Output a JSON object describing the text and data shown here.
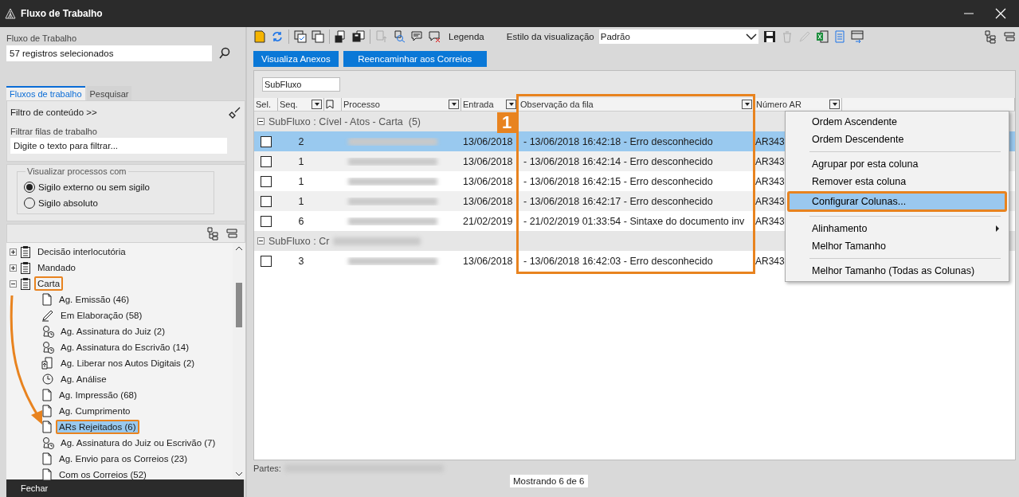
{
  "window": {
    "title": "Fluxo de Trabalho"
  },
  "left_panel": {
    "label": "Fluxo de Trabalho",
    "search_value": "57 registros selecionados",
    "tabs": [
      {
        "label": "Fluxos de trabalho",
        "selected": true
      },
      {
        "label": "Pesquisar",
        "selected": false
      }
    ],
    "content_filter": "Filtro de conteúdo >>",
    "filter_label": "Filtrar filas de trabalho",
    "filter_placeholder": "Digite o texto para filtrar...",
    "visibility": {
      "title": "Visualizar processos com",
      "options": [
        {
          "label": "Sigilo externo ou sem sigilo",
          "selected": true
        },
        {
          "label": "Sigilo absoluto",
          "selected": false
        }
      ]
    },
    "tree": [
      {
        "label": "Decisão interlocutória",
        "expanded": false,
        "callout": false
      },
      {
        "label": "Mandado",
        "expanded": false,
        "callout": false
      },
      {
        "label": "Carta",
        "expanded": true,
        "callout": true,
        "children": [
          {
            "label": "Ag. Emissão (46)",
            "kind": "document",
            "selected": false,
            "callout": false
          },
          {
            "label": "Em Elaboração (58)",
            "kind": "pen",
            "selected": false,
            "callout": false
          },
          {
            "label": "Ag. Assinatura do Juiz (2)",
            "kind": "signature",
            "selected": false,
            "callout": false
          },
          {
            "label": "Ag. Assinatura do Escrivão (14)",
            "kind": "signature",
            "selected": false,
            "callout": false
          },
          {
            "label": "Ag. Liberar nos Autos Digitais (2)",
            "kind": "release",
            "selected": false,
            "callout": false
          },
          {
            "label": "Ag. Análise",
            "kind": "clock",
            "selected": false,
            "callout": false
          },
          {
            "label": "Ag. Impressão (68)",
            "kind": "document",
            "selected": false,
            "callout": false
          },
          {
            "label": "Ag. Cumprimento",
            "kind": "document",
            "selected": false,
            "callout": false
          },
          {
            "label": "ARs Rejeitados (6)",
            "kind": "document",
            "selected": true,
            "callout": true
          },
          {
            "label": "Ag. Assinatura do Juiz ou Escrivão (7)",
            "kind": "signature",
            "selected": false,
            "callout": false
          },
          {
            "label": "Ag. Envio para os Correios (23)",
            "kind": "document",
            "selected": false,
            "callout": false
          },
          {
            "label": "Com os Correios (52)",
            "kind": "document",
            "selected": false,
            "callout": false
          }
        ]
      }
    ],
    "close_button": "Fechar"
  },
  "toolbar": {
    "legend": "Legenda",
    "view_style_label": "Estilo da visualização",
    "view_style_value": "Padrão"
  },
  "action_buttons": [
    "Visualiza Anexos",
    "Reencaminhar aos Correios"
  ],
  "group_by": [
    "SubFluxo"
  ],
  "table": {
    "columns": [
      {
        "label": "Sel.",
        "callout": false
      },
      {
        "label": "Seq.",
        "callout": false
      },
      {
        "label": "Processo",
        "callout": false
      },
      {
        "label": "Entrada",
        "callout": false
      },
      {
        "label": "Observação da fila",
        "callout": true,
        "callout_label": "1"
      },
      {
        "label": "Número AR",
        "callout": false
      }
    ],
    "groups": [
      {
        "title": "SubFluxo : Cível - Atos - Carta  (5)",
        "rows": [
          {
            "selected": true,
            "checked": false,
            "seq": "2",
            "entrada": "13/06/2018",
            "observacao": "- 13/06/2018 16:42:18 - Erro desconhecido",
            "numero_ar": "AR343"
          },
          {
            "selected": false,
            "checked": false,
            "seq": "1",
            "entrada": "13/06/2018",
            "observacao": "- 13/06/2018 16:42:14 - Erro desconhecido",
            "numero_ar": "AR343"
          },
          {
            "selected": false,
            "checked": false,
            "seq": "1",
            "entrada": "13/06/2018",
            "observacao": "- 13/06/2018 16:42:15 - Erro desconhecido",
            "numero_ar": "AR343"
          },
          {
            "selected": false,
            "checked": false,
            "seq": "1",
            "entrada": "13/06/2018",
            "observacao": "- 13/06/2018 16:42:17 - Erro desconhecido",
            "numero_ar": "AR343"
          },
          {
            "selected": false,
            "checked": false,
            "seq": "6",
            "entrada": "21/02/2019",
            "observacao": "- 21/02/2019 01:33:54 - Sintaxe do documento inv",
            "numero_ar": "AR343"
          }
        ]
      },
      {
        "title": "SubFluxo : Cr",
        "rows": [
          {
            "selected": false,
            "checked": false,
            "seq": "3",
            "entrada": "13/06/2018",
            "observacao": "- 13/06/2018 16:42:03 - Erro desconhecido",
            "numero_ar": "AR343"
          }
        ]
      }
    ]
  },
  "context_menu": [
    {
      "kind": "item",
      "label": "Ordem Ascendente",
      "selected": false,
      "callout": false
    },
    {
      "kind": "item",
      "label": "Ordem Descendente",
      "selected": false,
      "callout": false
    },
    {
      "kind": "separator"
    },
    {
      "kind": "item",
      "label": "Agrupar por esta coluna",
      "selected": false,
      "callout": false
    },
    {
      "kind": "item",
      "label": "Remover esta coluna",
      "selected": false,
      "callout": false
    },
    {
      "kind": "item",
      "label": "Configurar Colunas...",
      "selected": true,
      "callout": true
    },
    {
      "kind": "separator"
    },
    {
      "kind": "submenu",
      "label": "Alinhamento",
      "selected": false,
      "callout": false
    },
    {
      "kind": "item",
      "label": "Melhor Tamanho",
      "selected": false,
      "callout": false
    },
    {
      "kind": "separator"
    },
    {
      "kind": "item",
      "label": "Melhor Tamanho (Todas as Colunas)",
      "selected": false,
      "callout": false
    }
  ],
  "status": {
    "parts_label": "Partes:",
    "count": "Mostrando 6 de 6"
  }
}
